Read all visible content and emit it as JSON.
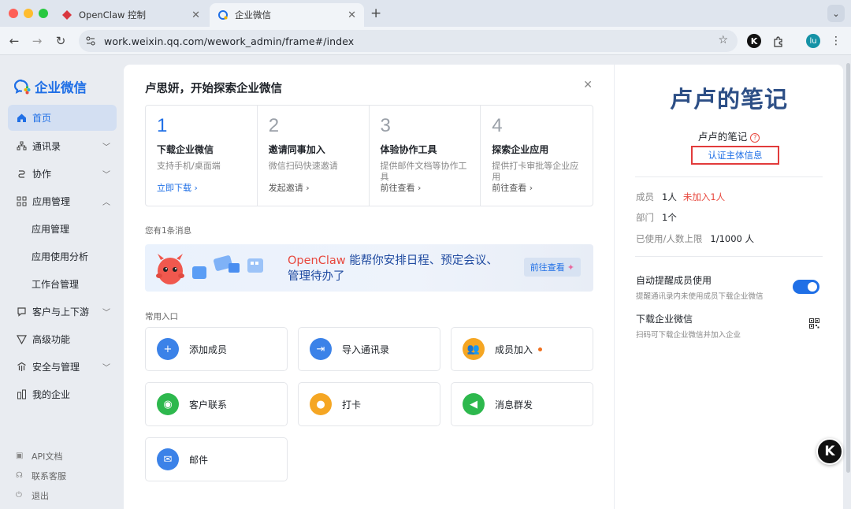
{
  "browser": {
    "tabs": [
      {
        "title": "OpenClaw 控制",
        "active": false
      },
      {
        "title": "企业微信",
        "active": true
      }
    ],
    "url": "work.weixin.qq.com/wework_admin/frame#/index",
    "profile_initials": "lu",
    "ext_letter": "K"
  },
  "sidebar": {
    "logo_text": "企业微信",
    "items": [
      {
        "label": "首页",
        "icon": "home-icon",
        "active": true
      },
      {
        "label": "通讯录",
        "icon": "contacts-icon",
        "expandable": true
      },
      {
        "label": "协作",
        "icon": "collaborate-icon",
        "expandable": true
      },
      {
        "label": "应用管理",
        "icon": "apps-icon",
        "expanded": true
      },
      {
        "label": "应用管理",
        "sub": true
      },
      {
        "label": "应用使用分析",
        "sub": true
      },
      {
        "label": "工作台管理",
        "sub": true
      },
      {
        "label": "客户与上下游",
        "icon": "customer-icon",
        "expandable": true
      },
      {
        "label": "高级功能",
        "icon": "advanced-icon"
      },
      {
        "label": "安全与管理",
        "icon": "security-icon",
        "expandable": true
      },
      {
        "label": "我的企业",
        "icon": "company-icon"
      }
    ],
    "bottom_links": [
      {
        "label": "API文档",
        "icon": "api-icon"
      },
      {
        "label": "联系客服",
        "icon": "support-icon"
      },
      {
        "label": "退出",
        "icon": "logout-icon"
      }
    ]
  },
  "main": {
    "welcome": "卢思妍，开始探索企业微信",
    "steps": [
      {
        "num": "1",
        "title": "下载企业微信",
        "desc": "支持手机/桌面端",
        "link": "立即下载 ›"
      },
      {
        "num": "2",
        "title": "邀请同事加入",
        "desc": "微信扫码快速邀请",
        "link": "发起邀请 ›"
      },
      {
        "num": "3",
        "title": "体验协作工具",
        "desc": "提供邮件文档等协作工具",
        "link": "前往查看 ›"
      },
      {
        "num": "4",
        "title": "探索企业应用",
        "desc": "提供打卡审批等企业应用",
        "link": "前往查看 ›"
      }
    ],
    "message_count": "您有1条消息",
    "banner": {
      "brand": "OpenClaw",
      "text_line1": " 能帮你安排日程、预定会议、",
      "text_line2": "管理待办了",
      "button": "前往查看"
    },
    "common_title": "常用入口",
    "entries": [
      {
        "label": "添加成员",
        "color": "#3b82e8"
      },
      {
        "label": "导入通讯录",
        "color": "#3b82e8"
      },
      {
        "label": "成员加入",
        "color": "#f5a623",
        "dot": true
      },
      {
        "label": "客户联系",
        "color": "#2db84d"
      },
      {
        "label": "打卡",
        "color": "#f5a623"
      },
      {
        "label": "消息群发",
        "color": "#2db84d"
      },
      {
        "label": "邮件",
        "color": "#3b82e8"
      }
    ]
  },
  "right": {
    "company_big": "卢卢的笔记",
    "company_small": "卢卢的笔记",
    "verify_link": "认证主体信息",
    "members_label": "成员",
    "members_value": "1人",
    "members_warn": "未加入1人",
    "dept_label": "部门",
    "dept_value": "1个",
    "limit_label": "已使用/人数上限",
    "limit_value": "1/1000 人",
    "setting1_title": "自动提醒成员使用",
    "setting1_desc": "提醒通讯录内未使用成员下载企业微信",
    "setting2_title": "下载企业微信",
    "setting2_desc": "扫码可下载企业微信并加入企业"
  },
  "float_button": "K"
}
